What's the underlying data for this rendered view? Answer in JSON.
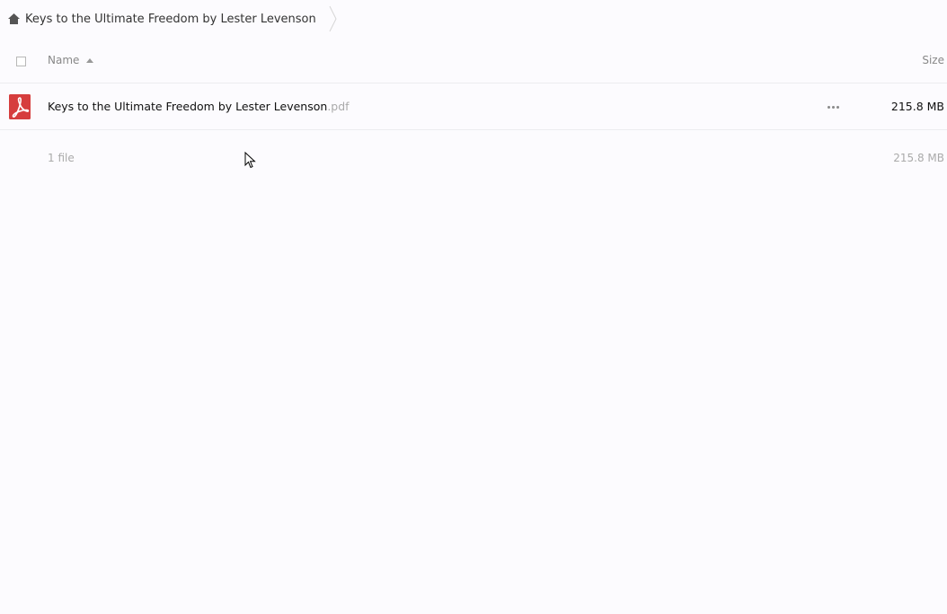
{
  "breadcrumb": {
    "home_icon": "home-icon",
    "label": "Keys to the Ultimate Freedom by Lester Levenson"
  },
  "table": {
    "header": {
      "name_label": "Name",
      "size_label": "Size"
    },
    "files": [
      {
        "icon": "pdf-icon",
        "name": "Keys to the Ultimate Freedom by Lester Levenson",
        "extension": ".pdf",
        "size": "215.8 MB"
      }
    ],
    "summary": {
      "count": "1 file",
      "total_size": "215.8 MB"
    }
  },
  "colors": {
    "pdf_red": "#d63d3d",
    "background": "#fcfbfe"
  }
}
